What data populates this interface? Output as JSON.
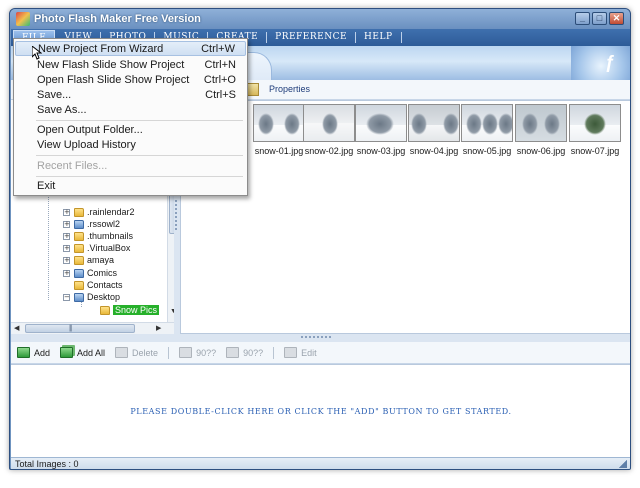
{
  "window": {
    "title": "Photo Flash Maker Free Version",
    "buttons": {
      "minimize": "_",
      "maximize": "□",
      "close": "✕"
    }
  },
  "menubar": {
    "items": [
      "File",
      "View",
      "Photo",
      "Music",
      "Create",
      "Preference",
      "Help"
    ]
  },
  "file_menu": {
    "items": [
      {
        "label": "New Project From Wizard",
        "shortcut": "Ctrl+W"
      },
      {
        "label": "New Flash Slide Show Project",
        "shortcut": "Ctrl+N"
      },
      {
        "label": "Open Flash Slide Show Project",
        "shortcut": "Ctrl+O"
      },
      {
        "label": "Save...",
        "shortcut": "Ctrl+S"
      },
      {
        "label": "Save As...",
        "shortcut": ""
      },
      {
        "label": "Open Output Folder...",
        "shortcut": ""
      },
      {
        "label": "View Upload History",
        "shortcut": ""
      },
      {
        "label": "Recent Files...",
        "shortcut": ""
      },
      {
        "label": "Exit",
        "shortcut": ""
      }
    ]
  },
  "toolbar": {
    "properties_label": "Properties"
  },
  "folder_tree": {
    "items": [
      {
        "label": ".rainlendar2",
        "expander": "+"
      },
      {
        "label": ".rssowl2",
        "expander": "+"
      },
      {
        "label": ".thumbnails",
        "expander": "+"
      },
      {
        "label": ".VirtualBox",
        "expander": "+"
      },
      {
        "label": "amaya",
        "expander": "+"
      },
      {
        "label": "Comics",
        "expander": "+"
      },
      {
        "label": "Contacts",
        "expander": ""
      },
      {
        "label": "Desktop",
        "expander": "−"
      },
      {
        "label": "Snow Pics",
        "expander": ""
      }
    ]
  },
  "thumbnails": {
    "items": [
      {
        "label": "snow-01.jpg"
      },
      {
        "label": "snow-02.jpg"
      },
      {
        "label": "snow-03.jpg"
      },
      {
        "label": "snow-04.jpg"
      },
      {
        "label": "snow-05.jpg"
      },
      {
        "label": "snow-06.jpg"
      },
      {
        "label": "snow-07.jpg"
      }
    ]
  },
  "actions": {
    "add": "Add",
    "add_all": "Add All",
    "delete": "Delete",
    "rotate_left": "90??",
    "rotate_right": "90??",
    "edit": "Edit"
  },
  "dropzone": {
    "hint": "Please double-click here or click the \"Add\" button to get started."
  },
  "status": {
    "total_images": "Total Images : 0"
  }
}
